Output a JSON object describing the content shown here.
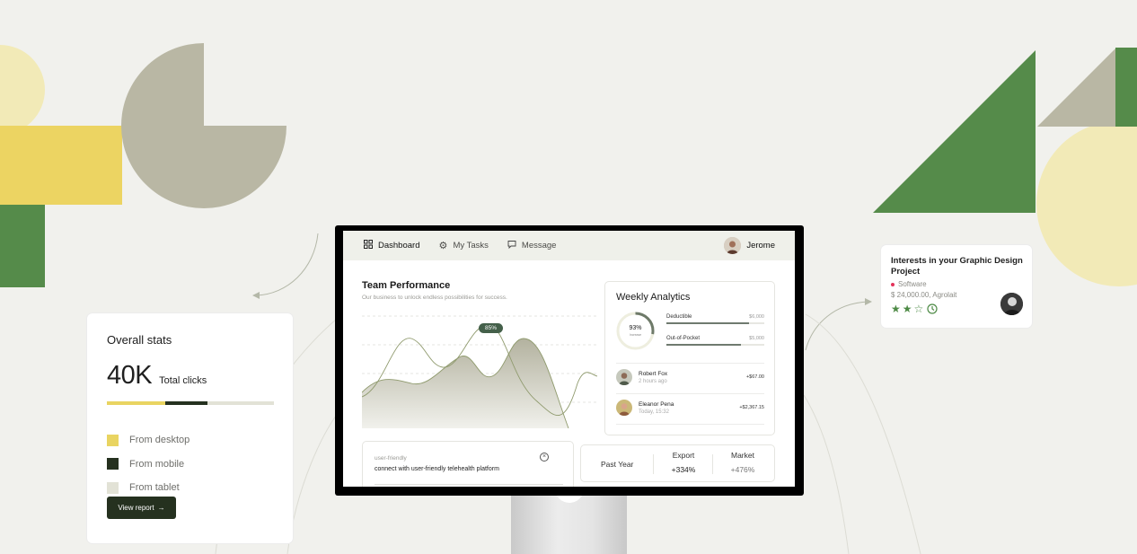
{
  "stats_card": {
    "title": "Overall stats",
    "total": "40K",
    "total_label": "Total clicks",
    "bar": [
      {
        "share": 0.35,
        "color": "#e9d461"
      },
      {
        "share": 0.25,
        "color": "#25311f"
      },
      {
        "share": 0.4,
        "color": "#e2e2d6"
      }
    ],
    "legend": [
      {
        "label": "From desktop",
        "color": "#e9d461"
      },
      {
        "label": "From mobile",
        "color": "#25311f"
      },
      {
        "label": "From tablet",
        "color": "#e2e2d6"
      }
    ],
    "view_report": "View report",
    "view_report_arrow": "→"
  },
  "interest_card": {
    "title": "Interests in your Graphic Design Project",
    "tag": "Software",
    "price": "$ 24,000.00, Agrolait",
    "rating": 2,
    "rating_max": 3,
    "icons": [
      "star-icon",
      "star-icon",
      "star-outline-icon",
      "clock-icon"
    ]
  },
  "nav": {
    "items": [
      {
        "label": "Dashboard",
        "icon": "grid-icon",
        "active": true
      },
      {
        "label": "My Tasks",
        "icon": "gear-icon",
        "active": false
      },
      {
        "label": "Message",
        "icon": "chat-icon",
        "active": false
      }
    ],
    "user_name": "Jerome"
  },
  "team": {
    "title": "Team Performance",
    "subtitle": "Our business to unlock endless possibilities for success.",
    "badge": "85%"
  },
  "weekly": {
    "title": "Weekly Analytics",
    "ring_pct": "93%",
    "ring_value": 0.93,
    "ring_label": "Increase",
    "metrics": [
      {
        "label": "Deductible",
        "amount": "$6,000",
        "fill": 0.84
      },
      {
        "label": "Out-of-Pocket",
        "amount": "$5,000",
        "fill": 0.76
      }
    ],
    "people": [
      {
        "name": "Robert Fox",
        "time": "2 hours ago",
        "amount": "+$67.00"
      },
      {
        "name": "Eleanor Pena",
        "time": "Today, 15:32",
        "amount": "+$2,367.15"
      }
    ]
  },
  "input_card": {
    "label": "user-friendly",
    "value": "connect with user-friendly telehealth platform",
    "close": "×"
  },
  "past_card": {
    "label": "Past Year",
    "columns": [
      {
        "title": "Export",
        "value": "+334%"
      },
      {
        "title": "Market",
        "value": "+476%"
      }
    ]
  },
  "colors": {
    "green": "#558b4a",
    "taupe": "#b9b7a4",
    "yellow": "#ecd462",
    "pale_yellow": "#f2eab7",
    "dark": "#25311f"
  }
}
